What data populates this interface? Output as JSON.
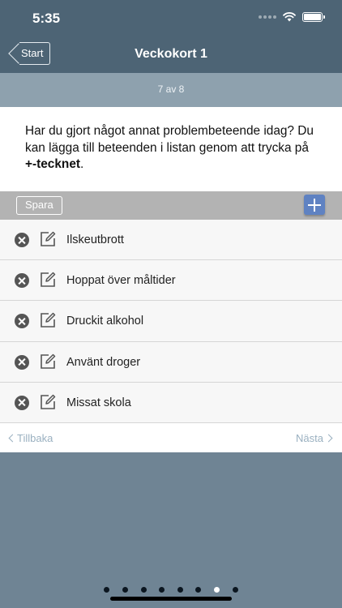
{
  "status": {
    "time": "5:35"
  },
  "nav": {
    "back_label": "Start",
    "title": "Veckokort 1"
  },
  "progress": {
    "text": "7 av 8",
    "current": 7,
    "total": 8
  },
  "question": {
    "line": "Har du gjort något annat problembeteende idag? Du kan lägga till beteenden i listan genom att trycka på ",
    "bold": "+-tecknet",
    "end": "."
  },
  "toolbar": {
    "save_label": "Spara"
  },
  "list": {
    "items": [
      {
        "label": "Ilskeutbrott"
      },
      {
        "label": "Hoppat över måltider"
      },
      {
        "label": "Druckit alkohol"
      },
      {
        "label": "Använt droger"
      },
      {
        "label": "Missat skola"
      }
    ]
  },
  "footer": {
    "prev_label": "Tillbaka",
    "next_label": "Nästa"
  },
  "pager": {
    "count": 8,
    "active_index": 6
  }
}
